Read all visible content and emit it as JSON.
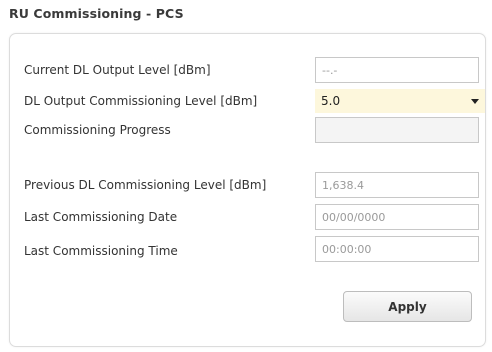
{
  "header": {
    "title": "RU Commissioning - PCS"
  },
  "form": {
    "current_dl_output_level": {
      "label": "Current DL Output Level [dBm]",
      "value": "--.-"
    },
    "dl_output_commissioning_level": {
      "label": "DL Output Commissioning Level [dBm]",
      "selected": "5.0"
    },
    "commissioning_progress": {
      "label": "Commissioning Progress",
      "value": ""
    },
    "previous_dl_commissioning_level": {
      "label": "Previous DL Commissioning Level [dBm]",
      "value": "1,638.4"
    },
    "last_commissioning_date": {
      "label": "Last Commissioning Date",
      "value": "00/00/0000"
    },
    "last_commissioning_time": {
      "label": "Last Commissioning Time",
      "value": "00:00:00"
    }
  },
  "actions": {
    "apply_label": "Apply"
  },
  "icons": {
    "dropdown": "chevron-down-icon"
  },
  "colors": {
    "select_highlight": "#fdf7dc",
    "text_primary": "#333333",
    "text_muted": "#9a9a9a",
    "border": "#c8c8c8"
  }
}
